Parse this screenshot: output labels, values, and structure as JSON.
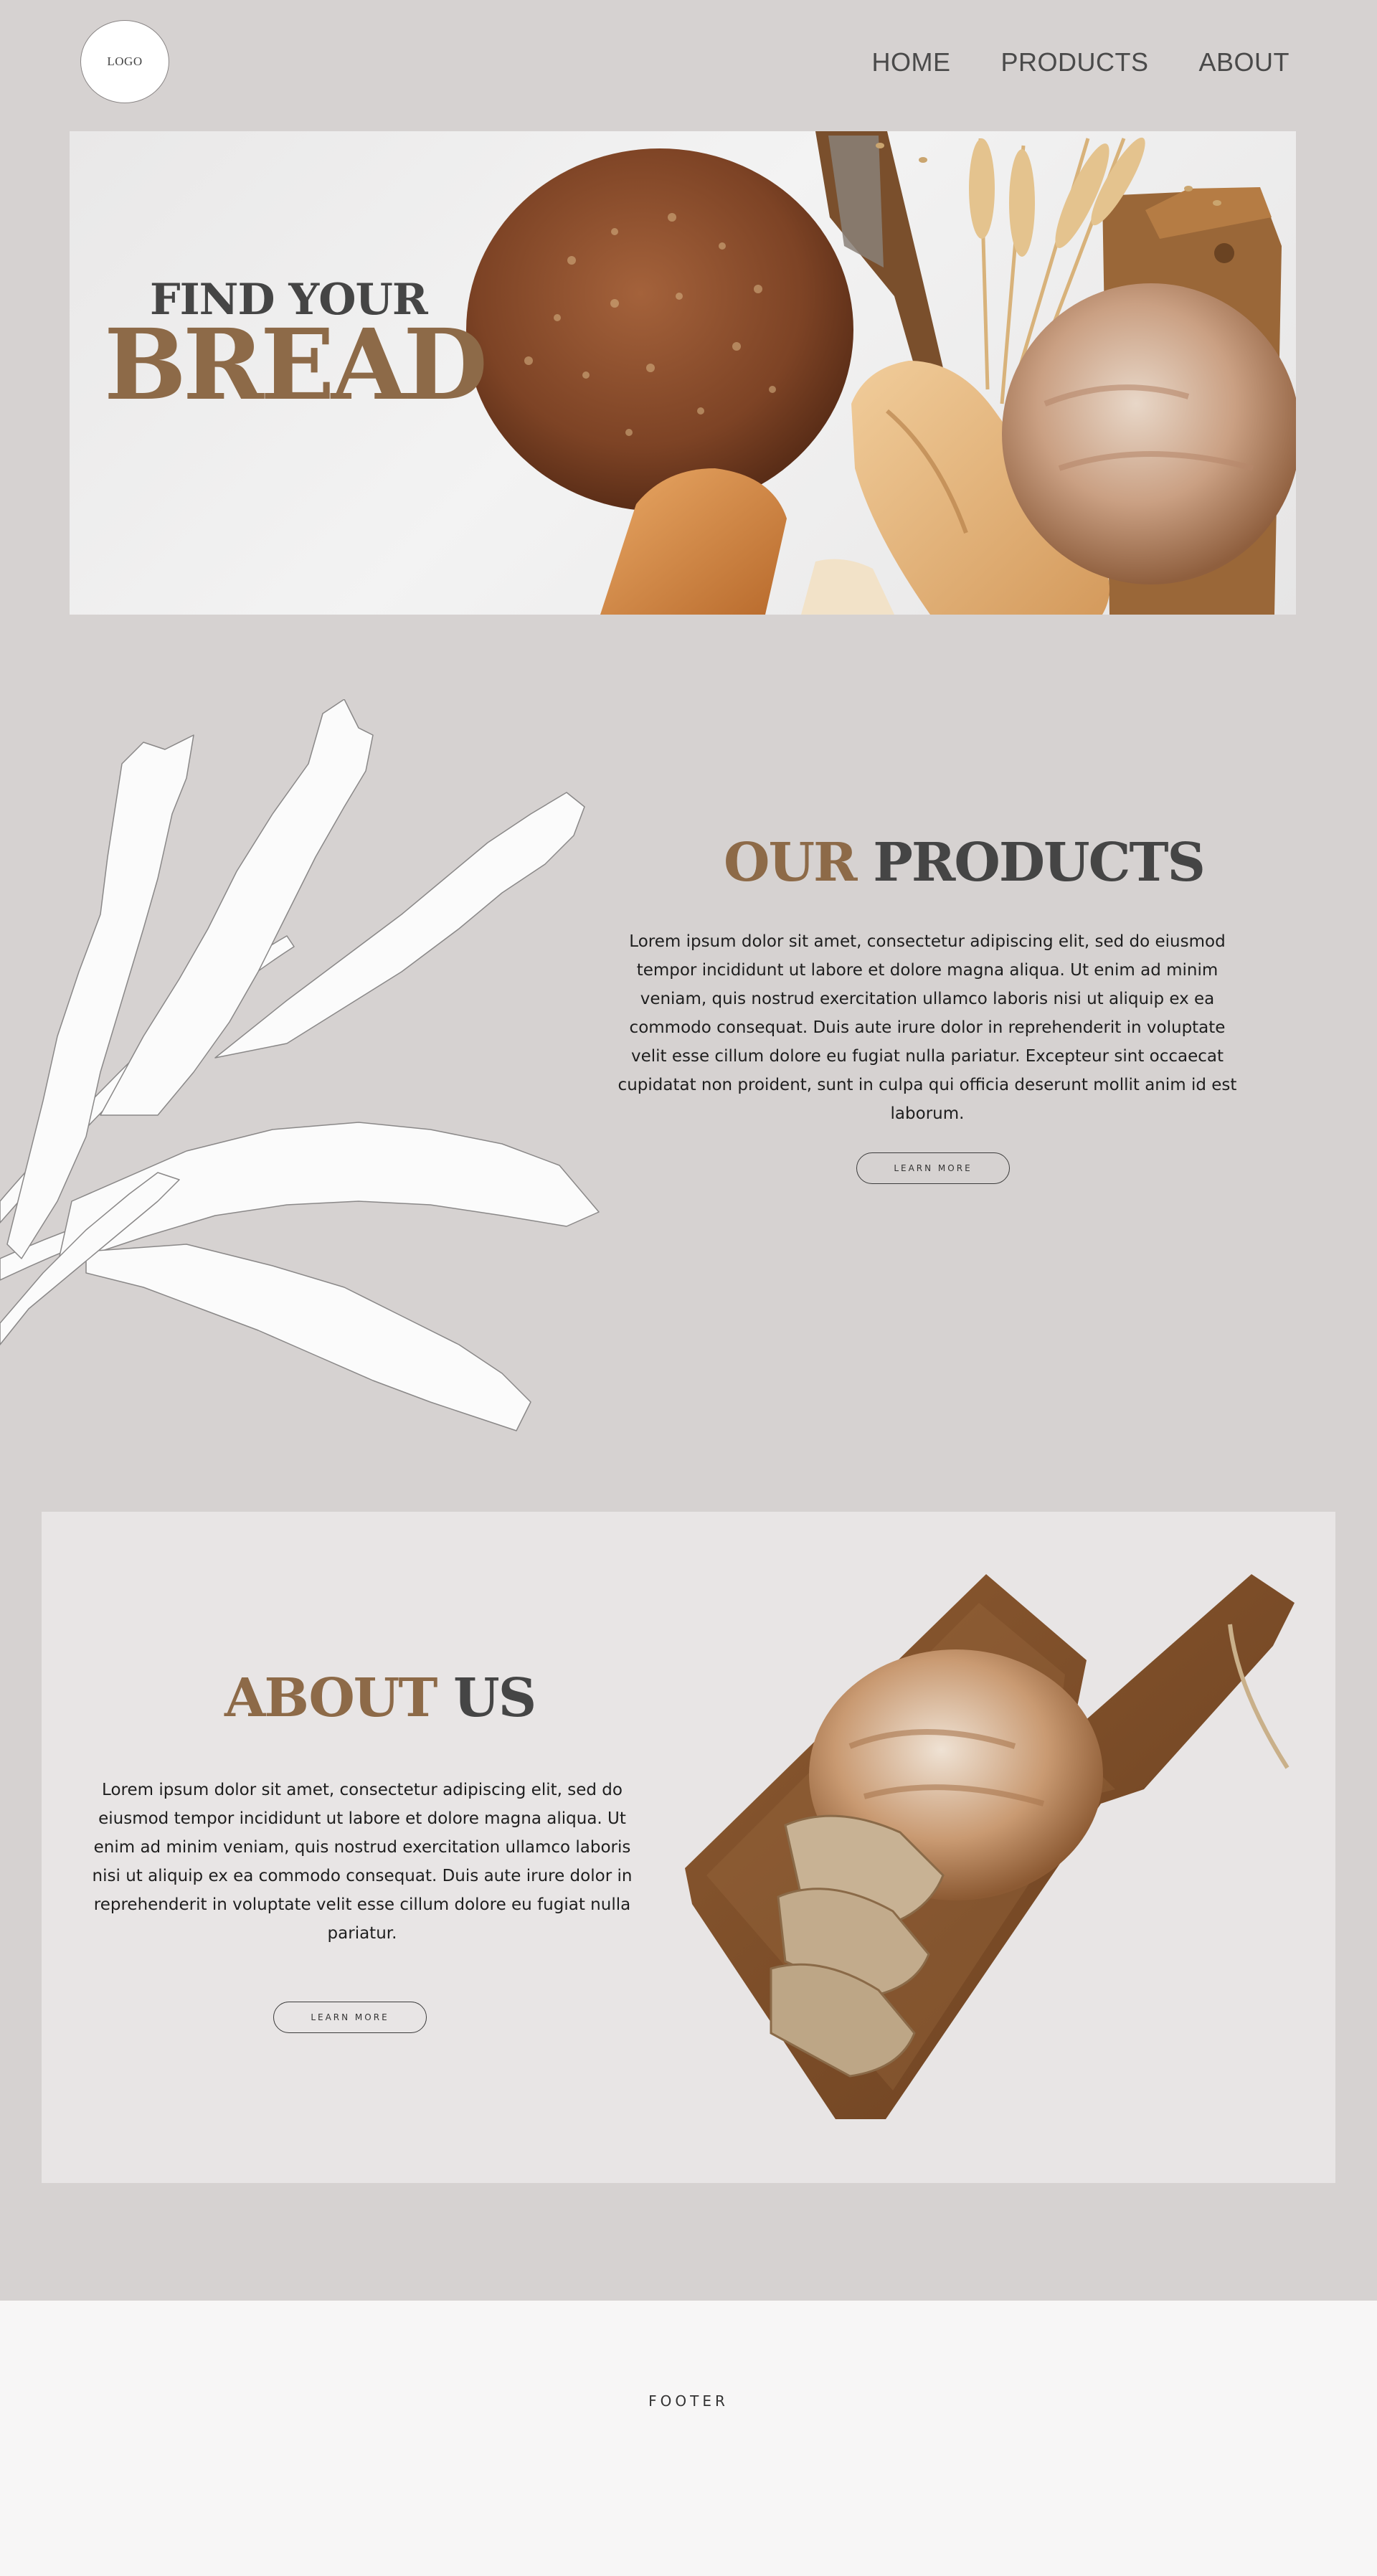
{
  "header": {
    "logo": "LOGO",
    "nav": [
      "HOME",
      "PRODUCTS",
      "ABOUT"
    ]
  },
  "hero": {
    "line1": "FIND YOUR",
    "line2": "BREAD"
  },
  "products": {
    "title_accent": "OUR",
    "title_rest": "PRODUCTS",
    "body": "Lorem ipsum dolor sit amet, consectetur adipiscing elit, sed do eiusmod tempor incididunt ut labore et dolore magna aliqua. Ut enim ad minim veniam, quis nostrud exercitation ullamco laboris nisi ut aliquip ex ea commodo consequat. Duis aute irure dolor in reprehenderit in voluptate velit esse cillum dolore eu fugiat nulla pariatur. Excepteur sint occaecat cupidatat non proident, sunt in culpa qui officia deserunt mollit anim id est laborum.",
    "button": "LEARN MORE"
  },
  "about": {
    "title_accent": "ABOUT",
    "title_rest": "US",
    "body": "Lorem ipsum dolor sit amet, consectetur adipiscing elit, sed do eiusmod tempor incididunt ut labore et dolore magna aliqua. Ut enim ad minim veniam, quis nostrud exercitation ullamco laboris nisi ut aliquip ex ea commodo consequat. Duis aute irure dolor in reprehenderit in voluptate velit esse cillum dolore eu fugiat nulla pariatur.",
    "button": "LEARN MORE"
  },
  "footer": {
    "label": "FOOTER"
  },
  "colors": {
    "page_bg": "#d6d2d1",
    "accent": "#8d6a48",
    "heading_dark": "#454545",
    "about_panel": "#e8e5e5",
    "footer_bg": "#f7f6f6"
  }
}
